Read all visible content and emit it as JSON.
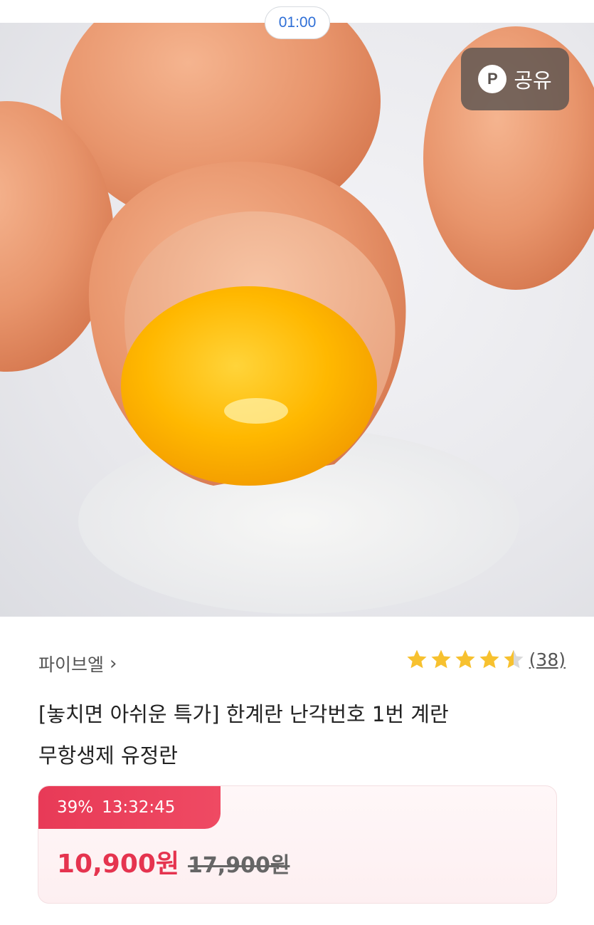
{
  "status": {
    "timer": "01:00"
  },
  "image": {
    "alt_icon": "cracked-egg-product-photo"
  },
  "share": {
    "icon_letter": "P",
    "label": "공유"
  },
  "seller": {
    "name": "파이브엘",
    "chevron": "›"
  },
  "rating": {
    "stars": 4.5,
    "review_count": "(38)"
  },
  "product": {
    "title_line1": "[놓치면 아쉬운 특가] 한계란 난각번호 1번 계란",
    "title_line2": "무항생제 유정란"
  },
  "deal": {
    "discount": "39%",
    "countdown": "13:32:45",
    "sale_price": "10,900원",
    "original_price": "17,900원"
  },
  "colors": {
    "accent_red": "#e5344f",
    "star_yellow": "#f7c12f",
    "timer_blue": "#2f6fd6"
  }
}
